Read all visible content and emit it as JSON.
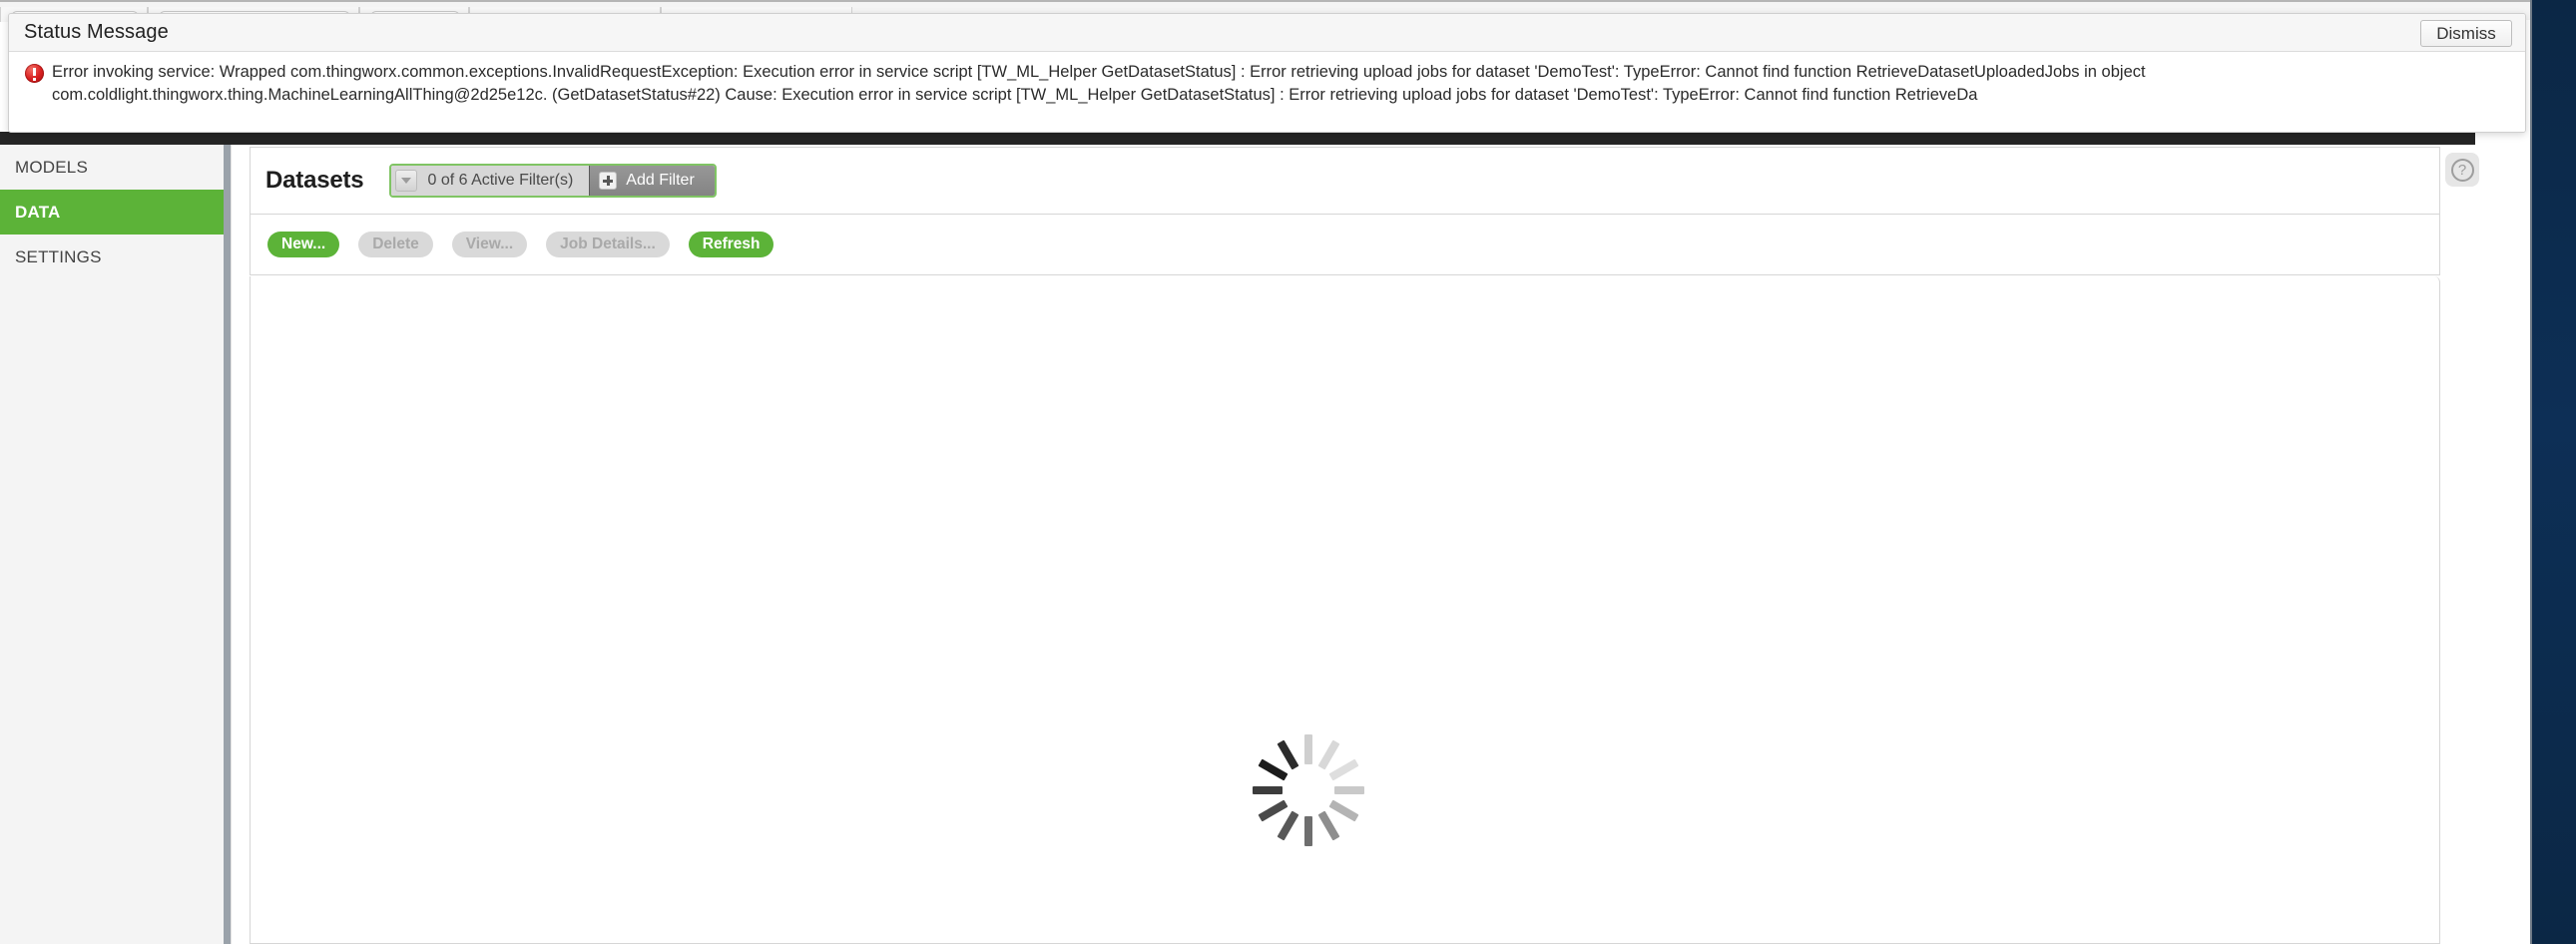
{
  "window": {
    "right_chrome_color": "#0c2b4e",
    "dark_bar_color": "#252525"
  },
  "status_dialog": {
    "title": "Status Message",
    "dismiss_label": "Dismiss",
    "icon": "error-circle-icon",
    "message_line1": "Error invoking service: Wrapped com.thingworx.common.exceptions.InvalidRequestException: Execution error in service script [TW_ML_Helper GetDatasetStatus] : Error retrieving upload jobs for dataset 'DemoTest': TypeError: Cannot find function RetrieveDatasetUploadedJobs in object",
    "message_line2": "com.coldlight.thingworx.thing.MachineLearningAllThing@2d25e12c. (GetDatasetStatus#22) Cause: Execution error in service script [TW_ML_Helper GetDatasetStatus] : Error retrieving upload jobs for dataset 'DemoTest': TypeError: Cannot find function RetrieveDa"
  },
  "sidebar": {
    "items": [
      {
        "label": "MODELS",
        "active": false,
        "name": "sidebar-item-models"
      },
      {
        "label": "DATA",
        "active": true,
        "name": "sidebar-item-data"
      },
      {
        "label": "SETTINGS",
        "active": false,
        "name": "sidebar-item-settings"
      }
    ],
    "active_color": "#5cb338"
  },
  "main": {
    "page_title": "Datasets",
    "filter": {
      "summary_label": "0 of 6 Active Filter(s)",
      "active_count": 0,
      "total_count": 6,
      "add_filter_label": "Add Filter",
      "caret_icon": "chevron-down-icon",
      "plus_icon": "plus-icon",
      "border_color": "#80c464"
    },
    "toolbar": {
      "buttons": [
        {
          "label": "New...",
          "state": "enabled",
          "name": "new-button"
        },
        {
          "label": "Delete",
          "state": "disabled",
          "name": "delete-button"
        },
        {
          "label": "View...",
          "state": "disabled",
          "name": "view-button"
        },
        {
          "label": "Job Details...",
          "state": "disabled",
          "name": "job-details-button"
        },
        {
          "label": "Refresh",
          "state": "enabled",
          "name": "refresh-button"
        }
      ],
      "primary_color": "#5cb338",
      "disabled_color": "#d9d9d9"
    },
    "content": {
      "state": "loading",
      "spinner_icon": "loading-spinner-icon",
      "spoke_count": 12,
      "spoke_colors": [
        "#cfcfcf",
        "#d8d8d8",
        "#dedede",
        "#c9c9c9",
        "#b4b4b4",
        "#8e8e8e",
        "#6e6e6e",
        "#585858",
        "#4a4a4a",
        "#3c3c3c",
        "#1c1c1c",
        "#2c2c2c"
      ]
    },
    "help": {
      "icon": "help-question-icon",
      "glyph": "?"
    }
  }
}
